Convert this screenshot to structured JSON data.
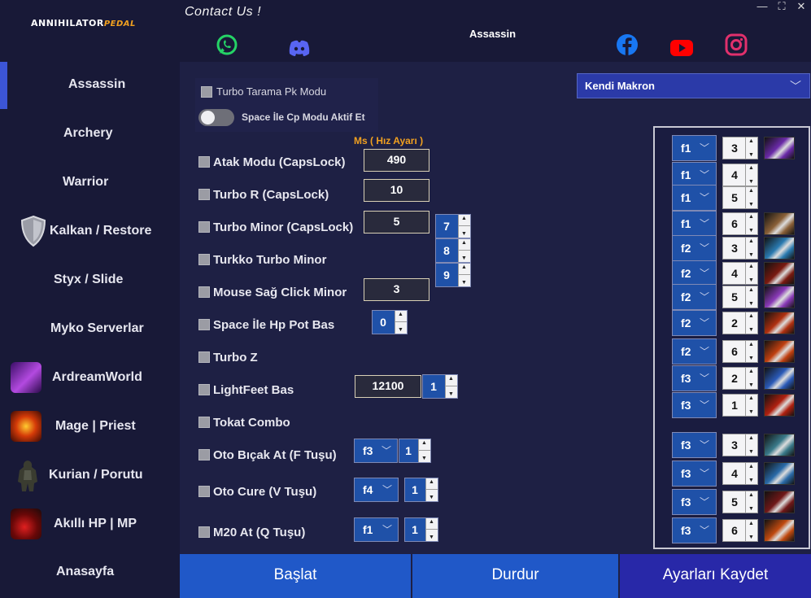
{
  "header": {
    "logo_main": "ANNIHILATOR",
    "logo_sub": "PEDAL",
    "contact": "Contact Us !",
    "page_title": "Assassin",
    "window_controls": [
      "—",
      "⛶",
      "✕"
    ],
    "social_icons": [
      "whatsapp-icon",
      "discord-icon",
      "facebook-icon",
      "youtube-icon",
      "instagram-icon"
    ]
  },
  "sidebar": {
    "items": [
      {
        "label": "Assassin",
        "active": true
      },
      {
        "label": "Archery"
      },
      {
        "label": "Warrior"
      },
      {
        "label": "Kalkan / Restore",
        "icon": "shield-icon"
      },
      {
        "label": "Styx / Slide"
      },
      {
        "label": "Myko Serverlar"
      },
      {
        "label": "ArdreamWorld",
        "icon": "ardream-icon"
      },
      {
        "label": "Mage | Priest",
        "icon": "mage-icon"
      },
      {
        "label": "Kurian / Porutu",
        "icon": "kurian-icon"
      },
      {
        "label": "Akıllı HP | MP",
        "icon": "potion-icon"
      },
      {
        "label": "Anasayfa"
      }
    ]
  },
  "top_panel": {
    "turbo_tarama": "Turbo Tarama Pk Modu",
    "space_cp": "Space İle Cp Modu Aktif Et"
  },
  "ms_label": "Ms ( Hız Ayarı )",
  "options": {
    "atak_modu": {
      "label": "Atak Modu (CapsLock)",
      "value": "490"
    },
    "turbo_r": {
      "label": "Turbo R (CapsLock)",
      "value": "10"
    },
    "turbo_minor": {
      "label": "Turbo Minor (CapsLock)",
      "value": "5",
      "spin": "7"
    },
    "turkko": {
      "label": "Turkko Turbo Minor",
      "spin": "8"
    },
    "mouse_sag": {
      "label": "Mouse Sağ Click Minor",
      "value": "3",
      "spin": "9"
    },
    "space_hp": {
      "label": "Space İle Hp Pot Bas",
      "spin": "0"
    },
    "turbo_z": {
      "label": "Turbo Z"
    },
    "lightfeet": {
      "label": "LightFeet Bas",
      "value": "12100",
      "spin": "1"
    },
    "tokat": {
      "label": "Tokat Combo"
    },
    "oto_bicak": {
      "label": "Oto Bıçak At (F Tuşu)",
      "key": "f3",
      "spin": "1"
    },
    "oto_cure": {
      "label": "Oto Cure (V Tuşu)",
      "key": "f4",
      "spin": "1"
    },
    "m20": {
      "label": "M20 At (Q Tuşu)",
      "key": "f1",
      "spin": "1"
    }
  },
  "makro": {
    "selected": "Kendi Makron"
  },
  "macro_rows": [
    {
      "key": "f1",
      "num": "3",
      "skill_color": "#6a2aa8"
    },
    {
      "key": "f1",
      "num": "4",
      "skill_color": ""
    },
    {
      "key": "f1",
      "num": "5",
      "skill_color": ""
    },
    {
      "key": "f1",
      "num": "6",
      "skill_color": "#8a6038"
    },
    {
      "key": "f2",
      "num": "3",
      "skill_color": "#2a7ab0"
    },
    {
      "key": "f2",
      "num": "4",
      "skill_color": "#7a1a10"
    },
    {
      "key": "f2",
      "num": "5",
      "skill_color": "#8a3ab8"
    },
    {
      "key": "f2",
      "num": "2",
      "skill_color": "#b03010"
    },
    {
      "key": "f2",
      "num": "6",
      "skill_color": "#c04010"
    },
    {
      "key": "f3",
      "num": "2",
      "skill_color": "#2a5ab8"
    },
    {
      "key": "f3",
      "num": "1",
      "skill_color": "#b02010"
    },
    {
      "key": "f3",
      "num": "3",
      "skill_color": "#3a7a8a"
    },
    {
      "key": "f3",
      "num": "4",
      "skill_color": "#2a6aa8"
    },
    {
      "key": "f3",
      "num": "5",
      "skill_color": "#701818"
    },
    {
      "key": "f3",
      "num": "6",
      "skill_color": "#c04a10"
    }
  ],
  "buttons": {
    "start": "Başlat",
    "stop": "Durdur",
    "save": "Ayarları Kaydet"
  },
  "colors": {
    "bg": "#1e2044",
    "sidebar": "#181937",
    "accent": "#3c55d6",
    "orange": "#f0a020",
    "button_blue": "#2058c8",
    "save_blue": "#2828a8"
  }
}
